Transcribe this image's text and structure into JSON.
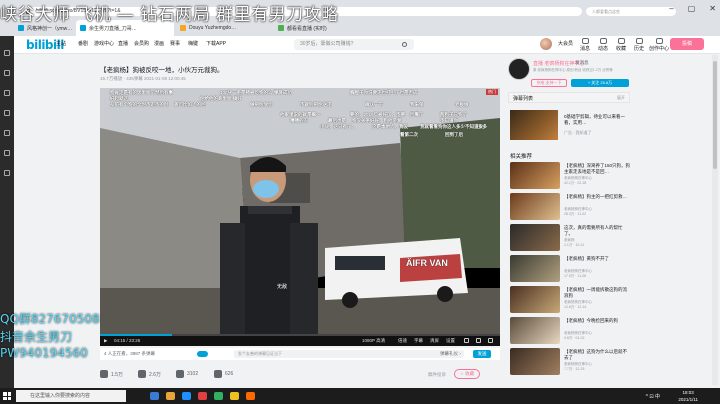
{
  "browser": {
    "url": "bilibili.com/video/BV15s41127yb?t=1&",
    "tabs": [
      "风格神创一（ymw…",
      "余生男刀直播_刀哥…",
      "Douyu Yuzhemgdo…",
      "都看看直播 (实时)"
    ],
    "search_placeholder": "人都爱看点这些"
  },
  "header": {
    "logo": "bilibili",
    "nav": [
      "主站",
      "番剧",
      "游戏中心",
      "直播",
      "会员购",
      "漫画",
      "赛事",
      "嗨键",
      "下载APP"
    ],
    "search_placeholder": "30岁后，靠做公司赚钱?",
    "user_name": "大会员",
    "user_links": [
      "消息",
      "动态",
      "收藏",
      "历史",
      "创作中心"
    ],
    "upload": "投稿"
  },
  "video": {
    "title": "【老疯杨】狗被反咬一地，小伙万元裁狗。",
    "meta": "15.7万播放 · 435弹幕   2021-01-08 12:00:45",
    "danmaku": [
      "狗肯定是有的饭里面了然后有事",
      "100块一条是猪被吃狗的么 弹屏成功",
      "胸膛子你说要走也打上了也是否成",
      "好起就这",
      "你给他的家里面   搞好",
      "从前有个狗的全时不走不的时",
      "盖可比如人的回",
      "做把你放什",
      "不就别把你送走",
      "确认一下",
      "我来保",
      "老板娘",
      "他家里说的就是嘛～",
      "要的，2019年被好了，不要",
      "回看了",
      "两狗子只狗了",
      "嘻嘻的方",
      "最后也是",
      "狗没关系好好，狗他亲爱",
      "不知道你",
      "小伙，这只有了。",
      "这是本地人，我没",
      "我就看看狗你这人多少不知道放",
      "多多",
      "看第二次",
      "回到了后"
    ],
    "van_text": "ÄIFR VAN",
    "shirt_text": "无敌",
    "time": "04:15 / 23:26",
    "progress": 0.18,
    "quality": "1080P 高清",
    "controls": [
      "倍速",
      "字幕",
      "清屏",
      "设置"
    ],
    "viewers": "4 人正在看，3987 条弹幕",
    "danmaku_placeholder": "发个友善的弹幕见证当下",
    "danmaku_etiquette": "弹幕礼仪 ›",
    "send": "发送",
    "overlay_tag": "热门"
  },
  "actions": {
    "like": "1.5万",
    "coin": "2.6万",
    "fav": "3102",
    "share": "626",
    "report": "稿件投诉",
    "fav_label": "☆ 收藏"
  },
  "uploader": {
    "name": "直播 老疯杨狗在神中心",
    "message": "发消息",
    "desc": "原 老疯杨狗在神中心 原创  粉丝 收获过1.2万 点赞等",
    "charge": "充电 支持一下",
    "follow": "+ 关注 25.6万"
  },
  "sidebar": {
    "danmaku_list": "弹幕列表",
    "danmaku_more": "展开",
    "ad_title": "0基础学剪辑，待业可以来看一看，实用…",
    "ad_sub": "广告 · 我知道了",
    "rec_title": "相关推荐",
    "recs": [
      {
        "title": "【老疯杨】深窝养了150只狗，狗主家走丢地是不是回…",
        "up": "老疯杨狗在神中心",
        "stats": "42.1万 · 02-28",
        "c1": "#5a3018",
        "c2": "#d8a060"
      },
      {
        "title": "【老疯杨】狗主的一把红剪救…",
        "up": "老疯杨狗在神中心",
        "stats": "28.3万 · 11-02",
        "c1": "#6b3a1a",
        "c2": "#e0c090"
      },
      {
        "title": "这次，真的需要所有人的帮忙了。",
        "up": "老疯杨",
        "stats": "2.1万 · 10-11",
        "c1": "#2a2a2a",
        "c2": "#8a6a4a"
      },
      {
        "title": "【老疯杨】黄狗不开了",
        "up": "老疯杨狗在神中心",
        "stats": "17.5万 · 11-08",
        "c1": "#3a3a30",
        "c2": "#b0a080"
      },
      {
        "title": "【老疯杨】一周能拆散这狗的流浪狗",
        "up": "老疯杨狗在神中心",
        "stats": "12.6万 · 12-14",
        "c1": "#4a3020",
        "c2": "#c8a878"
      },
      {
        "title": "【老疯杨】今晚捡回来的狗",
        "up": "老疯杨狗在神中心",
        "stats": "9.8万 · 01-02",
        "c1": "#5a4a3a",
        "c2": "#e8d8c0"
      },
      {
        "title": "【老疯杨】这狗为什么以后就不去了",
        "up": "老疯杨狗在神中心",
        "stats": "7.7万 · 12-25",
        "c1": "#3a2a20",
        "c2": "#a08060"
      }
    ]
  },
  "overlay": {
    "top": "峡谷大师 飞机 — 钻石两局 群里有男刀攻略",
    "qq": "QQ群827670508",
    "douyin": "抖音余生男刀",
    "pw": "PW940194560"
  },
  "taskbar": {
    "search": "在这里输入你要搜索的内容",
    "time": "18:03",
    "date": "2021/1/11",
    "tray": "^ ⊡ 中"
  }
}
